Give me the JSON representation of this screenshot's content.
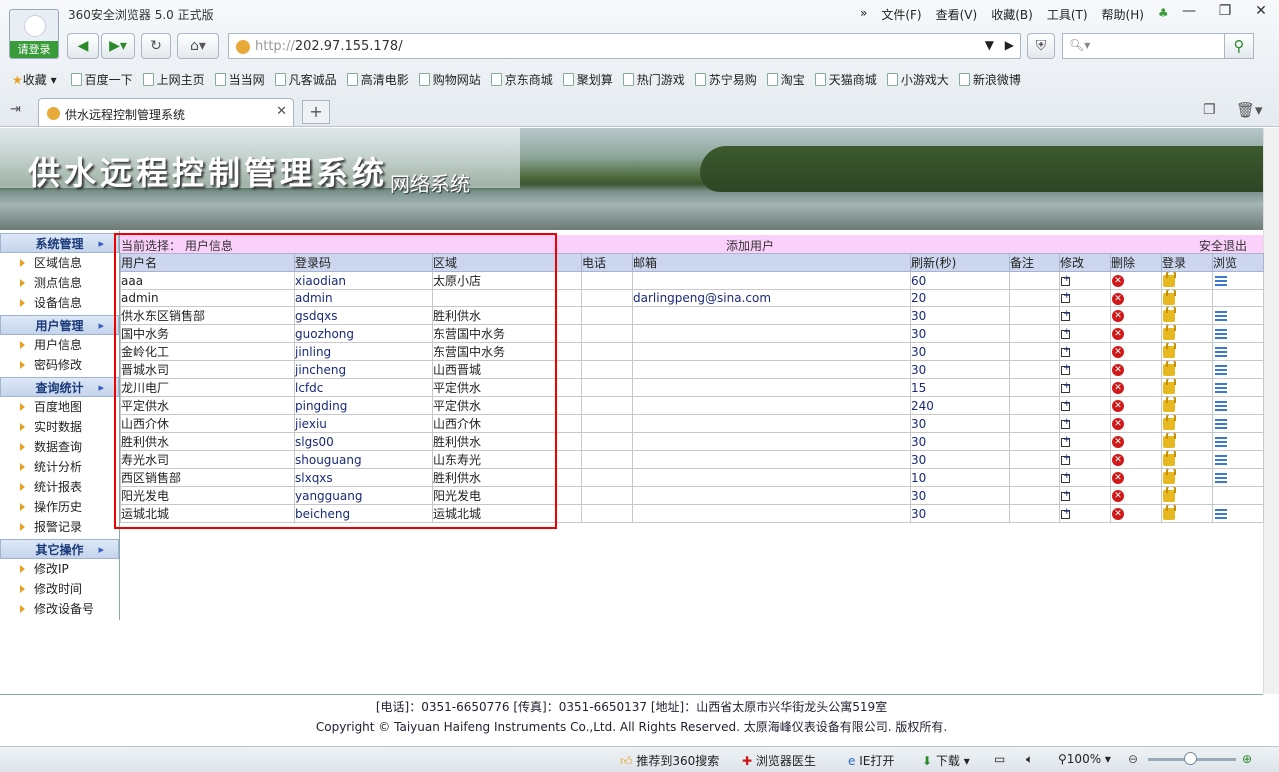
{
  "browser": {
    "window_title": "360安全浏览器 5.0 正式版",
    "login_label": "请登录",
    "menu": [
      "文件(F)",
      "查看(V)",
      "收藏(B)",
      "工具(T)",
      "帮助(H)"
    ],
    "address": {
      "scheme": "http://",
      "host": "202.97.155.178/"
    },
    "favorites_label": "收藏",
    "favorites": [
      "百度一下",
      "上网主页",
      "当当网",
      "凡客诚品",
      "高清电影",
      "购物网站",
      "京东商城",
      "聚划算",
      "热门游戏",
      "苏宁易购",
      "淘宝",
      "天猫商城",
      "小游戏大",
      "新浪微博"
    ],
    "tab_title": "供水远程控制管理系统",
    "status": {
      "recommend": "推荐到360搜索",
      "doctor": "浏览器医生",
      "ie_open": "IE打开",
      "download": "下载",
      "zoom": "100%"
    }
  },
  "banner": {
    "title": "供水远程控制管理系统",
    "subtitle": "网络系统"
  },
  "sidebar": [
    {
      "group": "系统管理",
      "items": [
        "区域信息",
        "测点信息",
        "设备信息"
      ]
    },
    {
      "group": "用户管理",
      "items": [
        "用户信息",
        "密码修改"
      ]
    },
    {
      "group": "查询统计",
      "items": [
        "百度地图",
        "实时数据",
        "数据查询",
        "统计分析",
        "统计报表",
        "操作历史",
        "报警记录"
      ]
    },
    {
      "group": "其它操作",
      "items": [
        "修改IP",
        "修改时间",
        "修改设备号"
      ]
    }
  ],
  "content": {
    "current_label": "当前选择：",
    "current_value": "用户信息",
    "add_user": "添加用户",
    "logout": "安全退出",
    "columns": [
      "用户名",
      "登录码",
      "区域",
      "电话",
      "邮箱",
      "刷新(秒)",
      "备注",
      "修改",
      "删除",
      "登录",
      "浏览"
    ],
    "rows": [
      {
        "name": "aaa",
        "code": "xiaodian",
        "region": "太原小店",
        "phone": "",
        "email": "",
        "refresh": "60",
        "note": "",
        "view": true
      },
      {
        "name": "admin",
        "code": "admin",
        "region": "",
        "phone": "",
        "email": "darlingpeng@sina.com",
        "refresh": "20",
        "note": "",
        "view": false
      },
      {
        "name": "供水东区销售部",
        "code": "gsdqxs",
        "region": "胜利供水",
        "phone": "",
        "email": "",
        "refresh": "30",
        "note": "",
        "view": true
      },
      {
        "name": "国中水务",
        "code": "guozhong",
        "region": "东营国中水务",
        "phone": "",
        "email": "",
        "refresh": "30",
        "note": "",
        "view": true
      },
      {
        "name": "金岭化工",
        "code": "jinling",
        "region": "东营国中水务",
        "phone": "",
        "email": "",
        "refresh": "30",
        "note": "",
        "view": true
      },
      {
        "name": "晋城水司",
        "code": "jincheng",
        "region": "山西晋城",
        "phone": "",
        "email": "",
        "refresh": "30",
        "note": "",
        "view": true
      },
      {
        "name": "龙川电厂",
        "code": "lcfdc",
        "region": "平定供水",
        "phone": "",
        "email": "",
        "refresh": "15",
        "note": "",
        "view": true
      },
      {
        "name": "平定供水",
        "code": "pingding",
        "region": "平定供水",
        "phone": "",
        "email": "",
        "refresh": "240",
        "note": "",
        "view": true
      },
      {
        "name": "山西介休",
        "code": "jiexiu",
        "region": "山西介休",
        "phone": "",
        "email": "",
        "refresh": "30",
        "note": "",
        "view": true
      },
      {
        "name": "胜利供水",
        "code": "slgs00",
        "region": "胜利供水",
        "phone": "",
        "email": "",
        "refresh": "30",
        "note": "",
        "view": true
      },
      {
        "name": "寿光水司",
        "code": "shouguang",
        "region": "山东寿光",
        "phone": "",
        "email": "",
        "refresh": "30",
        "note": "",
        "view": true
      },
      {
        "name": "西区销售部",
        "code": "slxqxs",
        "region": "胜利供水",
        "phone": "",
        "email": "",
        "refresh": "10",
        "note": "",
        "view": true
      },
      {
        "name": "阳光发电",
        "code": "yangguang",
        "region": "阳光发电",
        "phone": "",
        "email": "",
        "refresh": "30",
        "note": "",
        "view": false
      },
      {
        "name": "运城北城",
        "code": "beicheng",
        "region": "运城北城",
        "phone": "",
        "email": "",
        "refresh": "30",
        "note": "",
        "view": true
      }
    ]
  },
  "footer": {
    "line1": "[电话]：0351-6650776 [传真]：0351-6650137 [地址]：山西省太原市兴华街龙头公寓519室",
    "line2": "Copyright © Taiyuan Haifeng Instruments Co.,Ltd. All Rights Reserved. 太原海峰仪表设备有限公司. 版权所有."
  }
}
